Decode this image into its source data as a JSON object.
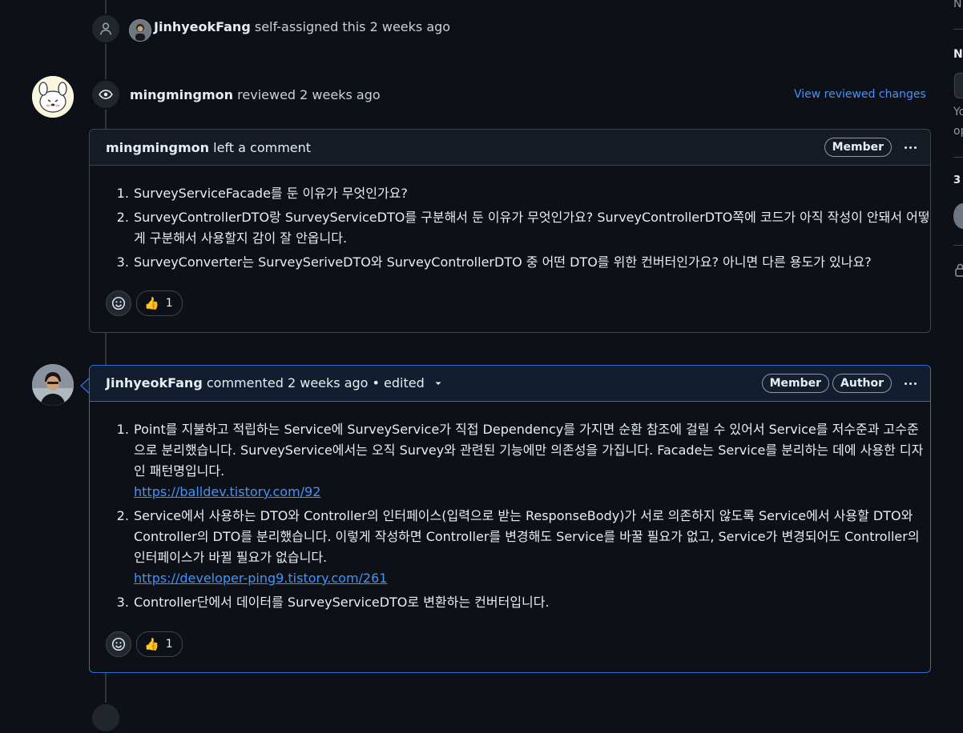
{
  "event_assign": {
    "user": "JinhyeokFang",
    "text": "self-assigned this 2 weeks ago"
  },
  "event_review": {
    "user": "mingmingmon",
    "text": "reviewed 2 weeks ago",
    "link": "View reviewed changes"
  },
  "comment1": {
    "author": "mingmingmon",
    "action": "left a comment",
    "badges": [
      "Member"
    ],
    "items": [
      "SurveyServiceFacade를 둔 이유가 무엇인가요?",
      "SurveyControllerDTO랑 SurveyServiceDTO를 구분해서 둔 이유가 무엇인가요? SurveyControllerDTO쪽에 코드가 아직 작성이 안돼서 어떻게 구분해서 사용할지 감이 잘 안옵니다.",
      "SurveyConverter는 SurveySeriveDTO와 SurveyControllerDTO 중 어떤 DTO를 위한 컨버터인가요? 아니면 다른 용도가 있나요?"
    ],
    "reaction_emoji": "👍",
    "reaction_count": "1"
  },
  "comment2": {
    "author": "JinhyeokFang",
    "action": "commented 2 weeks ago • edited",
    "badges": [
      "Member",
      "Author"
    ],
    "items": [
      {
        "text": "Point를 지불하고 적립하는 Service에 SurveyService가 직접 Dependency를 가지면 순환 참조에 걸릴 수 있어서 Service를 저수준과 고수준으로 분리했습니다. SurveyService에서는 오직 Survey와 관련된 기능에만 의존성을 가집니다. Facade는 Service를 분리하는 데에 사용한 디자인 패턴명입니다.",
        "link": "https://balldev.tistory.com/92"
      },
      {
        "text": "Service에서 사용하는 DTO와 Controller의 인터페이스(입력으로 받는 ResponseBody)가 서로 의존하지 않도록 Service에서 사용할 DTO와 Controller의 DTO를 분리했습니다. 이렇게 작성하면 Controller를 변경해도 Service를 바꿀 필요가 없고, Service가 변경되어도 Controller의 인터페이스가 바뀔 필요가 없습니다.",
        "link": "https://developer-ping9.tistory.com/261"
      },
      {
        "text": "Controller단에서 데이터를 SurveyServiceDTO로 변환하는 컨버터입니다.",
        "link": ""
      }
    ],
    "reaction_emoji": "👍",
    "reaction_count": "1"
  },
  "sidebar": {
    "fragments": [
      "N",
      "N",
      "Yo",
      "op",
      "3"
    ]
  },
  "colors": {
    "background": "#0d1117",
    "accent_link": "#4493f8",
    "author_border": "#316dca"
  }
}
